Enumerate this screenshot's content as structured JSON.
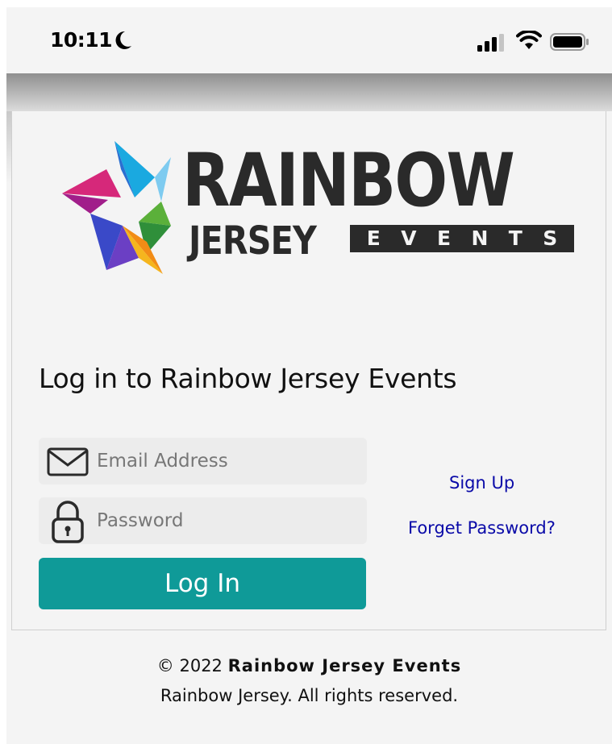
{
  "status_bar": {
    "time": "10:11",
    "icons": [
      "moon-icon",
      "cellular-signal-icon",
      "wifi-icon",
      "battery-icon"
    ]
  },
  "logo": {
    "word": "RAINBOW",
    "sub_left": "JERSEY",
    "sub_right_letters": [
      "E",
      "V",
      "E",
      "N",
      "T",
      "S"
    ]
  },
  "login": {
    "heading": "Log in to Rainbow Jersey Events",
    "email_placeholder": "Email Address",
    "password_placeholder": "Password",
    "button_label": "Log In",
    "signup_link": "Sign Up",
    "forgot_link": "Forget Password?"
  },
  "footer": {
    "copyright_prefix": "© 2022",
    "copyright_name": "Rainbow Jersey Events",
    "rights": "Rainbow Jersey. All rights reserved."
  },
  "colors": {
    "button": "#0f9a98",
    "link": "#0a0aa8",
    "background": "#f4f4f4"
  }
}
